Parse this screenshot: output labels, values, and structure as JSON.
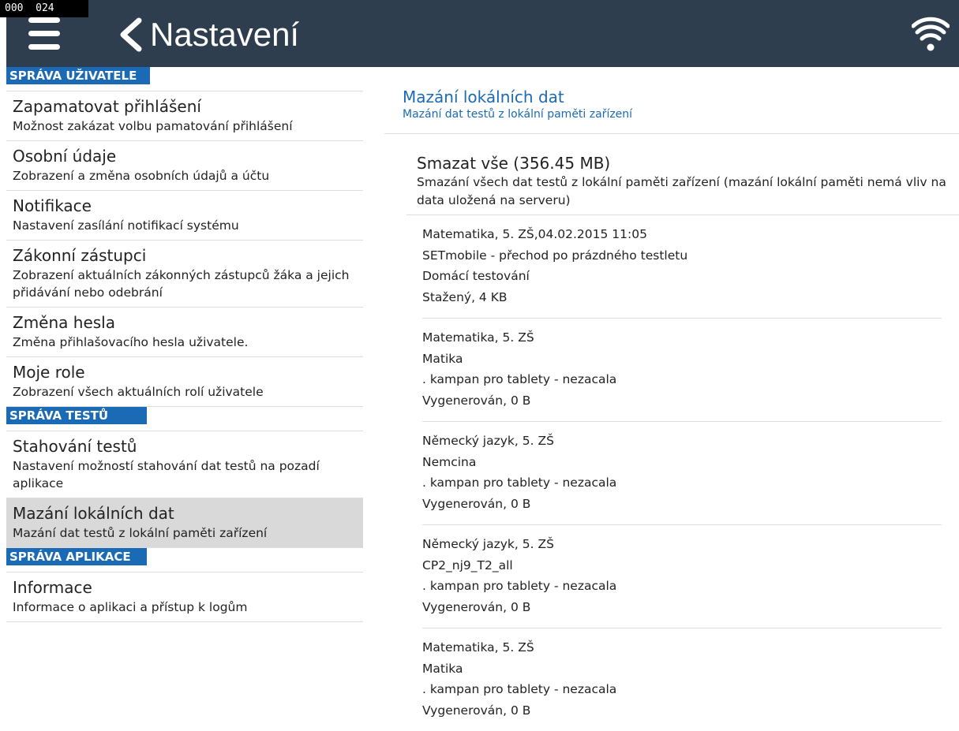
{
  "debug_counter": "000  024",
  "header": {
    "title": "Nastavení",
    "menu_icon": "hamburger-icon",
    "back_icon": "chevron-left-icon",
    "status_icon": "wifi-icon"
  },
  "colors": {
    "topbar": "#2e3e4f",
    "accent": "#1b6ab5",
    "selected": "#d9d9d9"
  },
  "sidebar": {
    "sections": [
      {
        "header": "SPRÁVA UŽIVATELE",
        "items": [
          {
            "title": "Zapamatovat přihlášení",
            "subtitle": "Možnost zakázat volbu pamatování přihlášení"
          },
          {
            "title": "Osobní údaje",
            "subtitle": "Zobrazení a změna osobních údajů a účtu"
          },
          {
            "title": "Notifikace",
            "subtitle": "Nastavení zasílání notifikací systému"
          },
          {
            "title": "Zákonní zástupci",
            "subtitle": "Zobrazení aktuálních zákonných zástupců žáka a jejich přidávání nebo odebrání"
          },
          {
            "title": "Změna hesla",
            "subtitle": "Změna přihlašovacího hesla uživatele."
          },
          {
            "title": "Moje role",
            "subtitle": "Zobrazení všech aktuálních rolí uživatele"
          }
        ]
      },
      {
        "header": "SPRÁVA TESTŮ",
        "items": [
          {
            "title": "Stahování testů",
            "subtitle": "Nastavení možností stahování dat testů na pozadí aplikace"
          },
          {
            "title": "Mazání lokálních dat",
            "subtitle": "Mazání dat testů z lokální paměti zařízení",
            "selected": true
          }
        ]
      },
      {
        "header": "SPRÁVA APLIKACE",
        "items": [
          {
            "title": "Informace",
            "subtitle": "Informace o aplikaci a přístup k logům"
          }
        ]
      }
    ]
  },
  "detail": {
    "title": "Mazání lokálních dat",
    "subtitle": "Mazání dat testů z lokální paměti zařízení",
    "delete_all": {
      "title": "Smazat vše (356.45 MB)",
      "description": "Smazání všech dat testů z lokální paměti zařízení (mazání lokální paměti nemá vliv na data uložená na serveru)"
    },
    "entries": [
      {
        "subject": "Matematika, 5. ZŠ,04.02.2015 11:05",
        "name": "SETmobile - přechod po prázdného testletu",
        "campaign": "Domácí testování",
        "status": "Stažený, 4 KB"
      },
      {
        "subject": "Matematika, 5. ZŠ",
        "name": "Matika",
        "campaign": ". kampan pro tablety - nezacala",
        "status": "Vygenerován, 0 B"
      },
      {
        "subject": "Německý jazyk, 5. ZŠ",
        "name": "Nemcina",
        "campaign": ". kampan pro tablety - nezacala",
        "status": "Vygenerován, 0 B"
      },
      {
        "subject": "Německý jazyk, 5. ZŠ",
        "name": "CP2_nj9_T2_all",
        "campaign": ". kampan pro tablety - nezacala",
        "status": "Vygenerován, 0 B"
      },
      {
        "subject": "Matematika, 5. ZŠ",
        "name": "Matika",
        "campaign": ". kampan pro tablety - nezacala",
        "status": "Vygenerován, 0 B"
      }
    ]
  }
}
